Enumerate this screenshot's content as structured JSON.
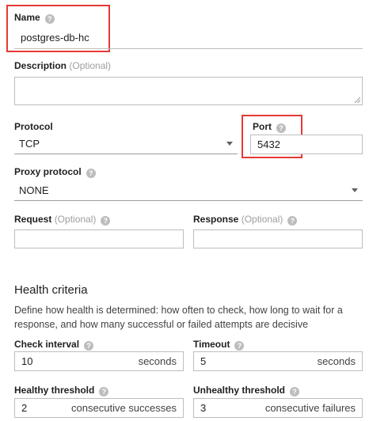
{
  "name": {
    "label": "Name",
    "value": "postgres-db-hc"
  },
  "description": {
    "label": "Description",
    "optional": "(Optional)",
    "value": ""
  },
  "protocol": {
    "label": "Protocol",
    "value": "TCP"
  },
  "port": {
    "label": "Port",
    "value": "5432"
  },
  "proxy_protocol": {
    "label": "Proxy protocol",
    "value": "NONE"
  },
  "request": {
    "label": "Request",
    "optional": "(Optional)",
    "value": ""
  },
  "response": {
    "label": "Response",
    "optional": "(Optional)",
    "value": ""
  },
  "health": {
    "title": "Health criteria",
    "description": "Define how health is determined: how often to check, how long to wait for a response, and how many successful or failed attempts are decisive"
  },
  "check_interval": {
    "label": "Check interval",
    "value": "10",
    "unit": "seconds"
  },
  "timeout": {
    "label": "Timeout",
    "value": "5",
    "unit": "seconds"
  },
  "healthy_threshold": {
    "label": "Healthy threshold",
    "value": "2",
    "unit": "consecutive successes"
  },
  "unhealthy_threshold": {
    "label": "Unhealthy threshold",
    "value": "3",
    "unit": "consecutive failures"
  },
  "icons": {
    "help": "help-circle-icon",
    "dropdown": "caret-down-icon"
  },
  "colors": {
    "highlight": "#e53935",
    "border": "#bdbdbd",
    "help_icon": "#bdbdbd"
  }
}
